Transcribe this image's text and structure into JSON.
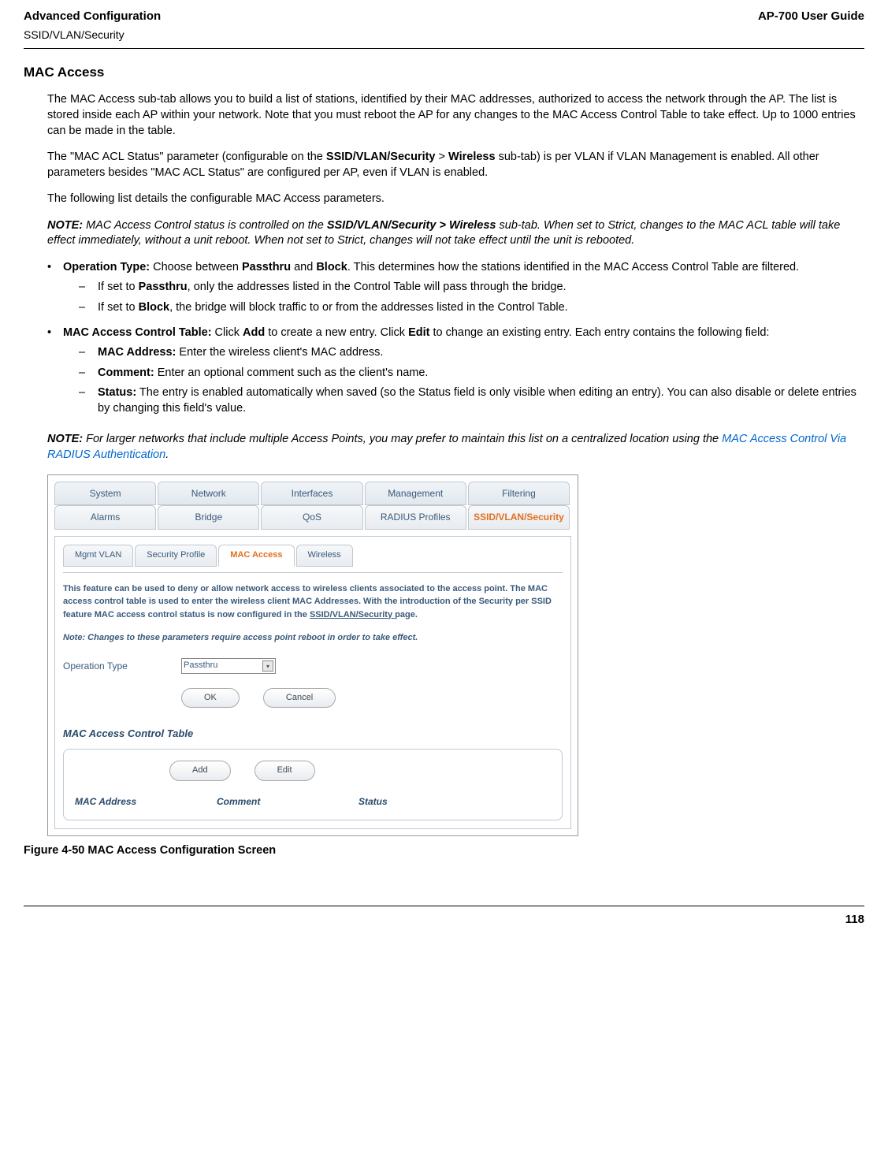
{
  "header": {
    "left_title": "Advanced Configuration",
    "left_sub": "SSID/VLAN/Security",
    "right_title": "AP-700 User Guide"
  },
  "section_title": "MAC Access",
  "p1": "The MAC Access sub-tab allows you to build a list of stations, identified by their MAC addresses, authorized to access the network through the AP. The list is stored inside each AP within your network. Note that you must reboot the AP for any changes to the MAC Access Control Table to take effect. Up to 1000 entries can be made in the table.",
  "p2_a": "The \"MAC ACL Status\" parameter (configurable on the ",
  "p2_b": "SSID/VLAN/Security",
  "p2_gt": " > ",
  "p2_c": "Wireless",
  "p2_d": " sub-tab) is per VLAN if VLAN Management is enabled. All other parameters besides \"MAC ACL Status\" are configured per AP, even if VLAN is enabled.",
  "p3": "The following list details the configurable MAC Access parameters.",
  "note1_label": "NOTE:",
  "note1_a": " MAC Access Control status is controlled on the ",
  "note1_b": "SSID/VLAN/Security > Wireless",
  "note1_c": " sub-tab. When set to Strict, changes to the MAC ACL table will take effect immediately, without a unit reboot. When not set to Strict, changes will not take effect until the unit is rebooted.",
  "bul1_label": "Operation Type:",
  "bul1_a": " Choose between ",
  "bul1_b": "Passthru",
  "bul1_and": " and ",
  "bul1_c": "Block",
  "bul1_d": ". This determines how the stations identified in the MAC Access Control Table are filtered.",
  "bul1_sub1_a": "If set to ",
  "bul1_sub1_b": "Passthru",
  "bul1_sub1_c": ", only the addresses listed in the Control Table will pass through the bridge.",
  "bul1_sub2_a": "If set to ",
  "bul1_sub2_b": "Block",
  "bul1_sub2_c": ", the bridge will block traffic to or from the addresses listed in the Control Table.",
  "bul2_label": "MAC Access Control Table:",
  "bul2_a": " Click ",
  "bul2_add": "Add",
  "bul2_b": " to create a new entry. Click ",
  "bul2_edit": "Edit",
  "bul2_c": " to change an existing entry. Each entry contains the following field:",
  "bul2_sub1_label": "MAC Address:",
  "bul2_sub1_a": " Enter the wireless client's MAC address.",
  "bul2_sub2_label": "Comment:",
  "bul2_sub2_a": " Enter an optional comment such as the client's name.",
  "bul2_sub3_label": "Status:",
  "bul2_sub3_a": " The entry is enabled automatically when saved (so the Status field is only visible when editing an entry). You can also disable or delete entries by changing this field's value.",
  "note2_label": "NOTE:",
  "note2_a": " For larger networks that include multiple Access Points, you may prefer to maintain this list on a centralized location using the ",
  "note2_link": "MAC Access Control Via RADIUS Authentication",
  "note2_b": ".",
  "ui": {
    "tabs1": [
      "System",
      "Network",
      "Interfaces",
      "Management",
      "Filtering"
    ],
    "tabs2": [
      "Alarms",
      "Bridge",
      "QoS",
      "RADIUS Profiles",
      "SSID/VLAN/Security"
    ],
    "subtabs": [
      "Mgmt VLAN",
      "Security Profile",
      "MAC Access",
      "Wireless"
    ],
    "desc_a": "This feature can be used to deny or allow network access to wireless clients associated to the access point. The MAC access control table is used to enter the wireless client MAC Addresses. With the introduction of the Security per SSID feature MAC access control status is now configured in the ",
    "desc_link": "SSID/VLAN/Security ",
    "desc_b": "page.",
    "note": "Note: Changes to these parameters require access point reboot in order to take effect.",
    "optype_label": "Operation Type",
    "optype_value": "Passthru",
    "ok": "OK",
    "cancel": "Cancel",
    "table_title": "MAC Access Control Table",
    "add": "Add",
    "edit": "Edit",
    "th_mac": "MAC Address",
    "th_comment": "Comment",
    "th_status": "Status"
  },
  "figure_caption": "Figure 4-50 MAC Access Configuration Screen",
  "page_number": "118"
}
